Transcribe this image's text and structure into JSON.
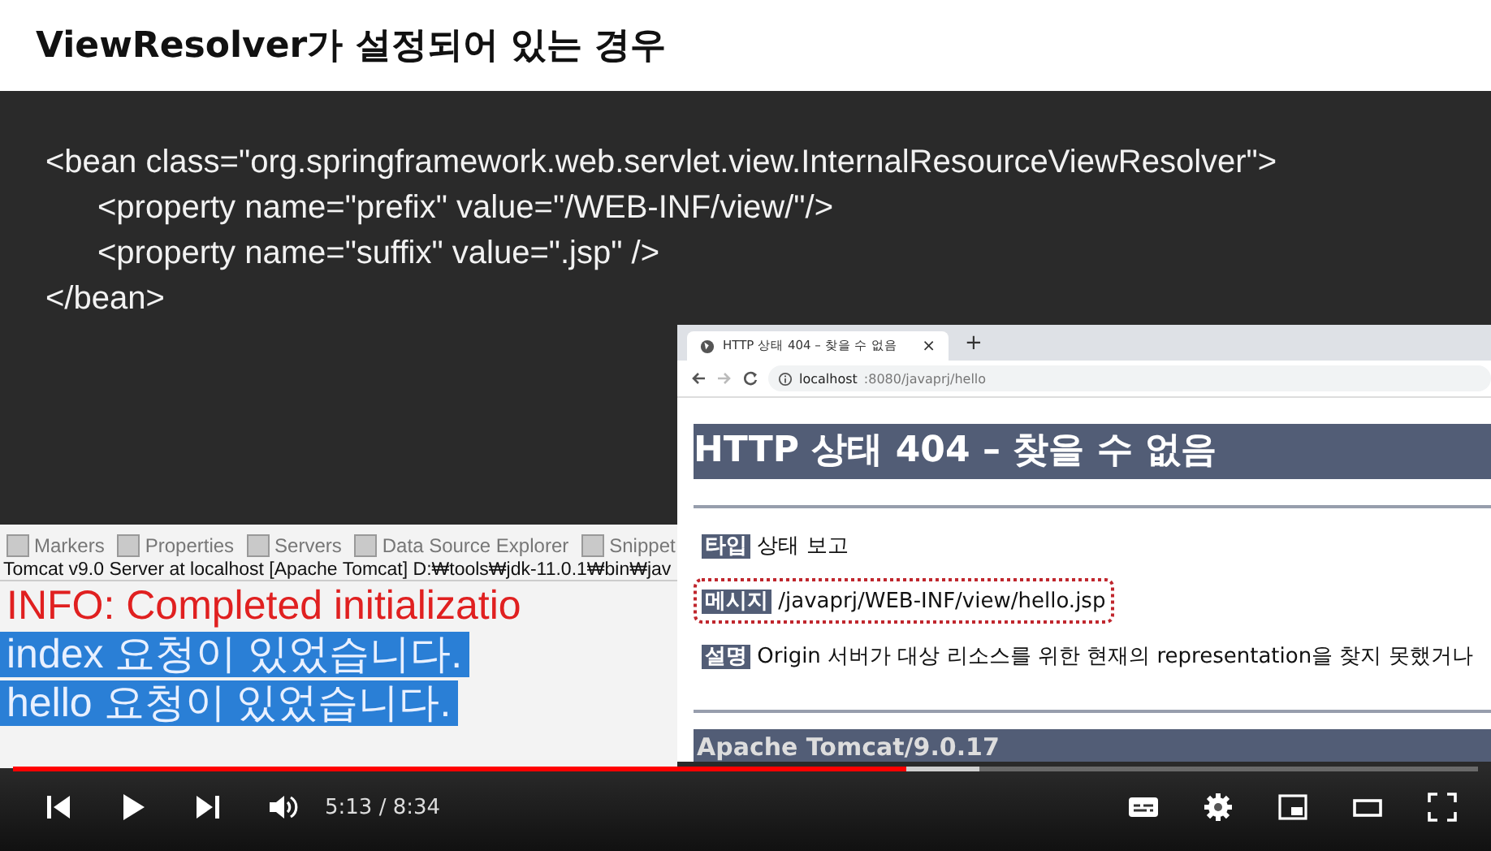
{
  "slide": {
    "title": "ViewResolver가 설정되어 있는 경우",
    "code_lines": [
      {
        "text": "<bean class=\"org.springframework.web.servlet.view.InternalResourceViewResolver\">",
        "indented": false
      },
      {
        "text": "<property name=\"prefix\" value=\"/WEB-INF/view/\"/>",
        "indented": true
      },
      {
        "text": "<property name=\"suffix\" value=\".jsp\" />",
        "indented": true
      },
      {
        "text": "</bean>",
        "indented": false
      }
    ]
  },
  "ide_console": {
    "tabs": [
      "Markers",
      "Properties",
      "Servers",
      "Data Source Explorer",
      "Snippet"
    ],
    "header": "Tomcat v9.0 Server at localhost [Apache Tomcat] D:₩tools₩jdk-11.0.1₩bin₩jav",
    "lines": [
      {
        "text": "INFO: Completed initializatio",
        "kind": "info",
        "selected": false
      },
      {
        "text": "index 요청이 있었습니다.",
        "kind": "output",
        "selected": true
      },
      {
        "text": "hello 요청이 있었습니다.",
        "kind": "output",
        "selected": true
      }
    ]
  },
  "browser": {
    "tab_title": "HTTP 상태 404 – 찾을 수 없음",
    "tab_close": "×",
    "new_tab": "+",
    "url_host": "localhost",
    "url_rest": ":8080/javaprj/hello",
    "heading": "HTTP 상태 404 – 찾을 수 없음",
    "fields": [
      {
        "label": "타입",
        "value": "상태 보고",
        "highlighted": false
      },
      {
        "label": "메시지",
        "value": "/javaprj/WEB-INF/view/hello.jsp",
        "highlighted": true
      },
      {
        "label": "설명",
        "value": "Origin 서버가 대상 리소스를 위한 현재의 representation을 찾지 못했거나",
        "highlighted": false
      }
    ],
    "footer": "Apache Tomcat/9.0.17"
  },
  "player": {
    "progress": {
      "level": 0.61
    },
    "buffered": {
      "level": 0.66
    },
    "time": "5:13 / 8:34"
  }
}
